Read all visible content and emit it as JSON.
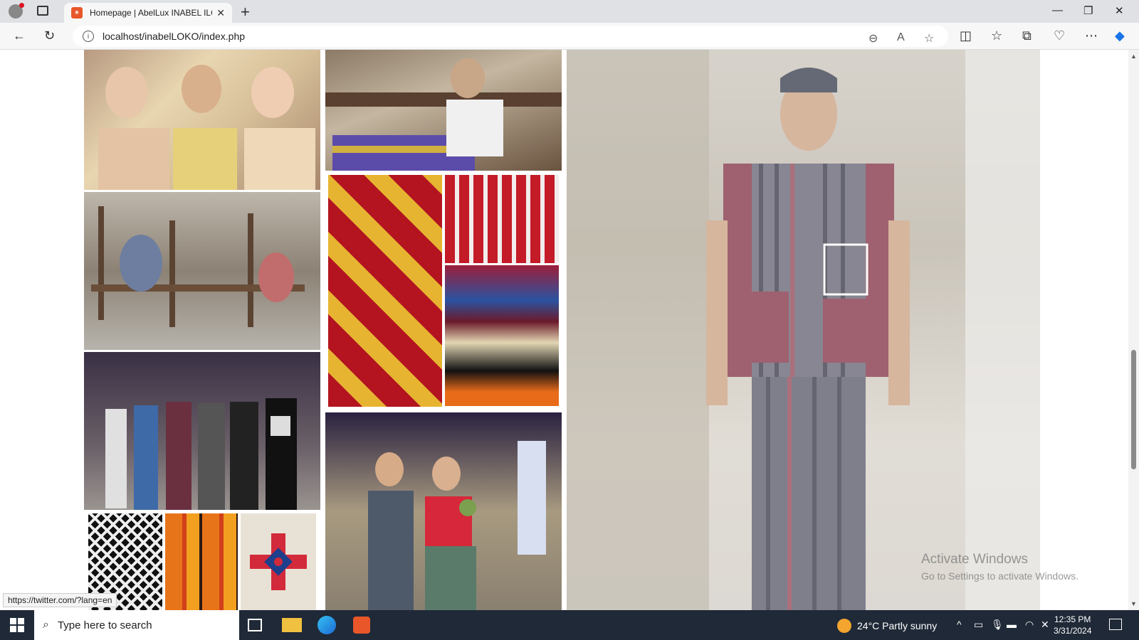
{
  "browser": {
    "tab_title": "Homepage | AbelLux INABEL ILO",
    "url": "localhost/inabelLOKO/index.php",
    "status_url": "https://twitter.com/?lang=en"
  },
  "watermark": {
    "line1": "Activate Windows",
    "line2": "Go to Settings to activate Windows."
  },
  "taskbar": {
    "search_placeholder": "Type here to search",
    "weather": "24°C  Partly sunny",
    "time": "12:35 PM",
    "date": "3/31/2024"
  },
  "gallery": {
    "images": [
      {
        "name": "three-elderly-women-photo"
      },
      {
        "name": "elderly-weaver-at-loom-photo"
      },
      {
        "name": "weavers-in-workshop-photo"
      },
      {
        "name": "red-yellow-inabel-fabric-photo"
      },
      {
        "name": "red-white-figure-fabric-photo"
      },
      {
        "name": "stacked-inabel-fabrics-photo"
      },
      {
        "name": "models-runway-lineup-photo"
      },
      {
        "name": "couple-in-inabel-attire-photo"
      },
      {
        "name": "black-white-weave-swatch"
      },
      {
        "name": "orange-stripe-weave-swatch"
      },
      {
        "name": "red-blue-motif-swatch"
      },
      {
        "name": "male-model-striped-suit-photo"
      }
    ]
  }
}
